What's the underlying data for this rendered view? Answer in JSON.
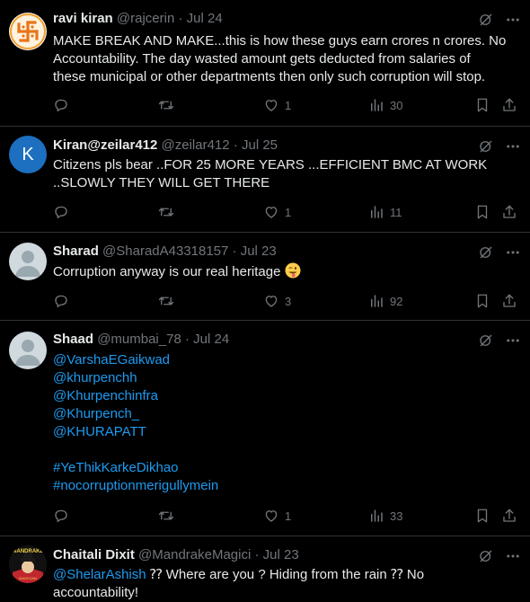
{
  "tweets": [
    {
      "name": "ravi kiran",
      "handle": "@rajcerin",
      "date": "Jul 24",
      "lines": [
        "MAKE BREAK AND MAKE...this is how these guys earn crores n crores. No",
        "Accountability. The day wasted amount gets deducted from salaries of",
        "these municipal or other departments then only such corruption will stop."
      ],
      "likes": "1",
      "views": "30"
    },
    {
      "name": "Kiran@zeilar412",
      "handle": "@zeilar412",
      "date": "Jul 25",
      "avatar_letter": "K",
      "lines": [
        "Citizens  pls bear ..FOR 25 MORE YEARS ...EFFICIENT BMC AT WORK",
        "..SLOWLY THEY WILL GET THERE"
      ],
      "likes": "1",
      "views": "11"
    },
    {
      "name": "Sharad",
      "handle": "@SharadA43318157",
      "date": "Jul 23",
      "text": "Corruption anyway is our real heritage",
      "emoji": "winking-face-with-tongue",
      "likes": "3",
      "views": "92"
    },
    {
      "name": "Shaad",
      "handle": "@mumbai_78",
      "date": "Jul 24",
      "links": [
        "@VarshaEGaikwad",
        "@khurpenchh",
        "@Khurpenchinfra",
        "@Khurpench_",
        "@KHURAPATT"
      ],
      "hashtags": [
        "#YeThikKarkeDikhao",
        "#nocorruptionmerigullymein"
      ],
      "likes": "1",
      "views": "33"
    },
    {
      "name": "Chaitali Dixit",
      "handle": "@MandrakeMagici",
      "date": "Jul 23",
      "mention": "@ShelarAshish",
      "text_after_mention": " ⁇ Where are you ? Hiding from the rain ⁇ No",
      "line2": "accountability!",
      "avatar_text": "MANDRAKE",
      "avatar_subtext": "MAGICIAN"
    }
  ],
  "separator": "·",
  "colors": {
    "background": "#000000",
    "text": "#e7e9ea",
    "muted": "#71767b",
    "link": "#1d9bf0",
    "border": "#2f3336"
  },
  "icons": [
    "grok-icon",
    "more-icon",
    "reply-icon",
    "retweet-icon",
    "like-icon",
    "views-icon",
    "bookmark-icon",
    "share-icon"
  ]
}
